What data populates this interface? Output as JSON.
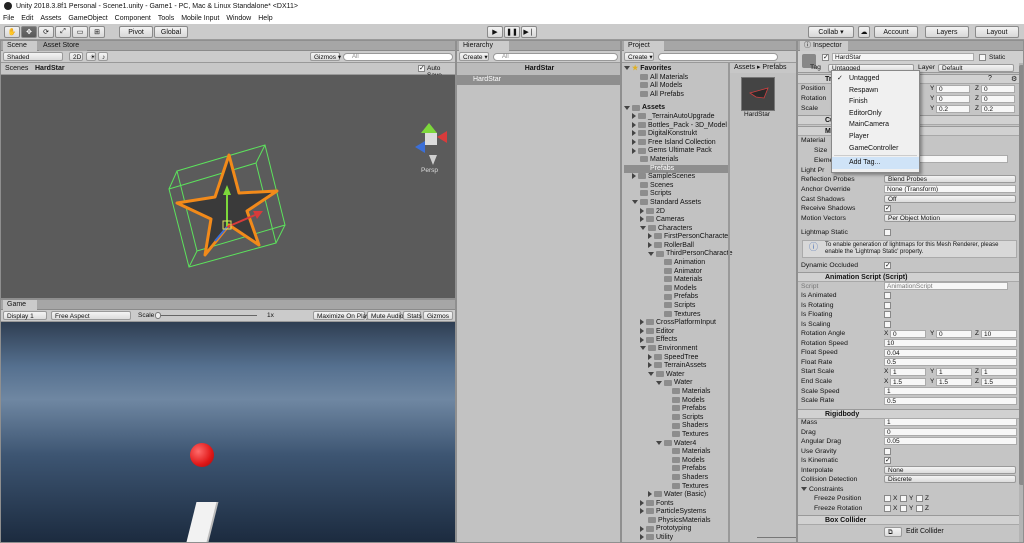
{
  "window": {
    "title": "Unity 2018.3.8f1 Personal - Scene1.unity - Game1 - PC, Mac & Linux Standalone* <DX11>"
  },
  "menu": [
    "File",
    "Edit",
    "Assets",
    "GameObject",
    "Component",
    "Tools",
    "Mobile Input",
    "Window",
    "Help"
  ],
  "toolbar": {
    "pivot": "Pivot",
    "global": "Global",
    "collab": "Collab ▾",
    "account": "Account",
    "layers": "Layers",
    "layout": "Layout"
  },
  "scene": {
    "tabs": [
      "Scene",
      "Asset Store"
    ],
    "shading": "Shaded",
    "mode2d": "2D",
    "gizmos": "Gizmos ▾",
    "search": "All",
    "breadcrumb_root": "Scenes",
    "breadcrumb_obj": "HardStar",
    "autosave": "Auto Save",
    "persp": "Persp",
    "colors": {
      "sky": "#5a5a5a",
      "selection": "#f28a1a",
      "bounds": "#5ce25c"
    }
  },
  "game": {
    "tab": "Game",
    "display": "Display 1",
    "aspect": "Free Aspect",
    "scale_label": "Scale",
    "scale_value": "1x",
    "maximize": "Maximize On Play",
    "mute": "Mute Audio",
    "stats": "Stats",
    "gizmos": "Gizmos"
  },
  "hierarchy": {
    "tab": "Hierarchy",
    "create": "Create ▾",
    "search": "All",
    "scene": "HardStar",
    "item": "HardStar"
  },
  "project": {
    "tab": "Project",
    "create": "Create ▾",
    "favorites": {
      "label": "Favorites",
      "items": [
        "All Materials",
        "All Models",
        "All Prefabs"
      ]
    },
    "assets_label": "Assets",
    "tree": [
      {
        "label": "_TerrainAutoUpgrade",
        "depth": 1,
        "arrow": "closed"
      },
      {
        "label": "Bottles_Pack - 3D_Model",
        "depth": 1,
        "arrow": "closed"
      },
      {
        "label": "DigitalKonstrukt",
        "depth": 1,
        "arrow": "closed"
      },
      {
        "label": "Free Island Collection",
        "depth": 1,
        "arrow": "closed"
      },
      {
        "label": "Gems Ultimate Pack",
        "depth": 1,
        "arrow": "closed"
      },
      {
        "label": "Materials",
        "depth": 1,
        "arrow": ""
      },
      {
        "label": "Prefabs",
        "depth": 1,
        "arrow": "",
        "selected": true
      },
      {
        "label": "SampleScenes",
        "depth": 1,
        "arrow": "closed"
      },
      {
        "label": "Scenes",
        "depth": 1,
        "arrow": ""
      },
      {
        "label": "Scripts",
        "depth": 1,
        "arrow": ""
      },
      {
        "label": "Standard Assets",
        "depth": 1,
        "arrow": "open"
      },
      {
        "label": "2D",
        "depth": 2,
        "arrow": "closed"
      },
      {
        "label": "Cameras",
        "depth": 2,
        "arrow": "closed"
      },
      {
        "label": "Characters",
        "depth": 2,
        "arrow": "open"
      },
      {
        "label": "FirstPersonCharacte",
        "depth": 3,
        "arrow": "closed"
      },
      {
        "label": "RollerBall",
        "depth": 3,
        "arrow": "closed"
      },
      {
        "label": "ThirdPersonCharacte",
        "depth": 3,
        "arrow": "open"
      },
      {
        "label": "Animation",
        "depth": 4,
        "arrow": ""
      },
      {
        "label": "Animator",
        "depth": 4,
        "arrow": ""
      },
      {
        "label": "Materials",
        "depth": 4,
        "arrow": ""
      },
      {
        "label": "Models",
        "depth": 4,
        "arrow": ""
      },
      {
        "label": "Prefabs",
        "depth": 4,
        "arrow": ""
      },
      {
        "label": "Scripts",
        "depth": 4,
        "arrow": ""
      },
      {
        "label": "Textures",
        "depth": 4,
        "arrow": ""
      },
      {
        "label": "CrossPlatformInput",
        "depth": 2,
        "arrow": "closed"
      },
      {
        "label": "Editor",
        "depth": 2,
        "arrow": "closed"
      },
      {
        "label": "Effects",
        "depth": 2,
        "arrow": "closed"
      },
      {
        "label": "Environment",
        "depth": 2,
        "arrow": "open"
      },
      {
        "label": "SpeedTree",
        "depth": 3,
        "arrow": "closed"
      },
      {
        "label": "TerrainAssets",
        "depth": 3,
        "arrow": "closed"
      },
      {
        "label": "Water",
        "depth": 3,
        "arrow": "open"
      },
      {
        "label": "Water",
        "depth": 4,
        "arrow": "open"
      },
      {
        "label": "Materials",
        "depth": 5,
        "arrow": ""
      },
      {
        "label": "Models",
        "depth": 5,
        "arrow": ""
      },
      {
        "label": "Prefabs",
        "depth": 5,
        "arrow": ""
      },
      {
        "label": "Scripts",
        "depth": 5,
        "arrow": ""
      },
      {
        "label": "Shaders",
        "depth": 5,
        "arrow": ""
      },
      {
        "label": "Textures",
        "depth": 5,
        "arrow": ""
      },
      {
        "label": "Water4",
        "depth": 4,
        "arrow": "open"
      },
      {
        "label": "Materials",
        "depth": 5,
        "arrow": ""
      },
      {
        "label": "Models",
        "depth": 5,
        "arrow": ""
      },
      {
        "label": "Prefabs",
        "depth": 5,
        "arrow": ""
      },
      {
        "label": "Shaders",
        "depth": 5,
        "arrow": ""
      },
      {
        "label": "Textures",
        "depth": 5,
        "arrow": ""
      },
      {
        "label": "Water (Basic)",
        "depth": 3,
        "arrow": "closed"
      },
      {
        "label": "Fonts",
        "depth": 2,
        "arrow": "closed"
      },
      {
        "label": "ParticleSystems",
        "depth": 2,
        "arrow": "closed"
      },
      {
        "label": "PhysicsMaterials",
        "depth": 2,
        "arrow": ""
      },
      {
        "label": "Prototyping",
        "depth": 2,
        "arrow": "closed"
      },
      {
        "label": "Utility",
        "depth": 2,
        "arrow": "closed"
      },
      {
        "label": "Vehicles",
        "depth": 2,
        "arrow": "closed"
      }
    ],
    "breadcrumb": [
      "Assets",
      "Prefabs"
    ],
    "asset": "HardStar"
  },
  "inspector": {
    "tab": "Inspector",
    "name": "HardStar",
    "static": "Static",
    "tag_label": "Tag",
    "tag_value": "Untagged",
    "layer_label": "Layer",
    "layer_value": "Default",
    "transform": {
      "title": "Tr",
      "position": "Position",
      "rotation": "Rotation",
      "scale": "Scale",
      "pos_y": "0",
      "pos_z": "0",
      "rot_y": "0",
      "rot_z": "0",
      "scale_y": "0.2",
      "scale_z": "0.2"
    },
    "cube": "Cu",
    "renderer_title": "M",
    "renderer_rows": [
      "Material",
      "Size",
      "Eleme",
      "Light Pr"
    ],
    "reflection_probes": "Reflection Probes",
    "reflection_value": "Blend Probes",
    "anchor_override": "Anchor Override",
    "anchor_value": "None (Transform)",
    "cast_shadows": "Cast Shadows",
    "cast_value": "Off",
    "receive_shadows": "Receive Shadows",
    "motion_vectors": "Motion Vectors",
    "motion_value": "Per Object Motion",
    "lightmap_static": "Lightmap Static",
    "lightmap_info": "To enable generation of lightmaps for this Mesh Renderer, please enable the 'Lightmap Static' property.",
    "dynamic_occluded": "Dynamic Occluded",
    "anim_script": {
      "title": "Animation Script (Script)",
      "script_label": "Script",
      "script_value": "AnimationScript",
      "is_animated": "Is Animated",
      "is_rotating": "Is Rotating",
      "is_floating": "Is Floating",
      "is_scaling": "Is Scaling",
      "rotation_angle": "Rotation Angle",
      "ra_x": "0",
      "ra_y": "0",
      "ra_z": "10",
      "rotation_speed": "Rotation Speed",
      "rs": "10",
      "float_speed": "Float Speed",
      "fs": "0.04",
      "float_rate": "Float Rate",
      "fr": "0.5",
      "start_scale": "Start Scale",
      "ss_x": "1",
      "ss_y": "1",
      "ss_z": "1",
      "end_scale": "End Scale",
      "es_x": "1.5",
      "es_y": "1.5",
      "es_z": "1.5",
      "scale_speed": "Scale Speed",
      "scs": "1",
      "scale_rate": "Scale Rate",
      "scr": "0.5"
    },
    "rigidbody": {
      "title": "Rigidbody",
      "mass": "Mass",
      "mass_v": "1",
      "drag": "Drag",
      "drag_v": "0",
      "angular_drag": "Angular Drag",
      "ad_v": "0.05",
      "use_gravity": "Use Gravity",
      "is_kinematic": "Is Kinematic",
      "interpolate": "Interpolate",
      "interp_v": "None",
      "collision": "Collision Detection",
      "coll_v": "Discrete",
      "constraints": "Constraints",
      "freeze_pos": "Freeze Position",
      "freeze_rot": "Freeze Rotation"
    },
    "box_collider": {
      "title": "Box Collider",
      "edit": "Edit Collider"
    }
  },
  "tag_menu": {
    "items": [
      "Untagged",
      "Respawn",
      "Finish",
      "EditorOnly",
      "MainCamera",
      "Player",
      "GameController"
    ],
    "add": "Add Tag..."
  },
  "axes": {
    "x": "X",
    "y": "Y",
    "z": "Z"
  }
}
